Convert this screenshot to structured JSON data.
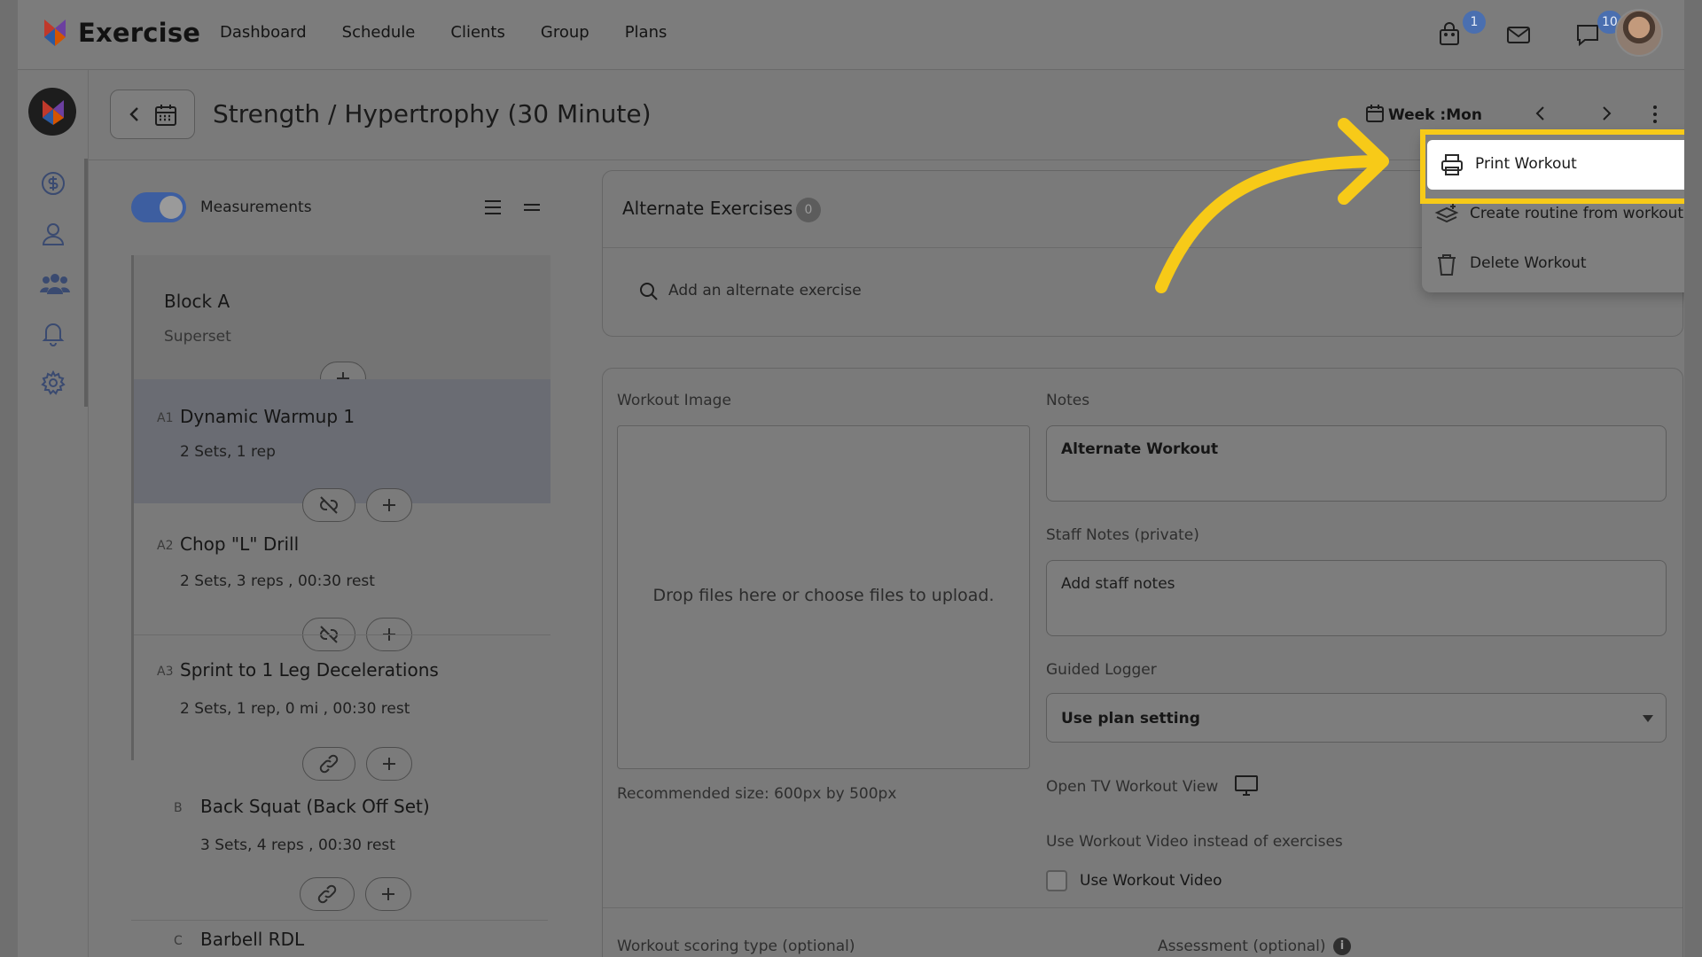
{
  "app": {
    "name": "Exercise",
    "nav": [
      "Dashboard",
      "Schedule",
      "Clients",
      "Group",
      "Plans"
    ],
    "badges": {
      "cart": "1",
      "messages": "10"
    }
  },
  "sidebar": {
    "icons": [
      "dollar-circle-icon",
      "user-icon",
      "group-icon",
      "bell-icon",
      "gear-icon"
    ]
  },
  "header": {
    "title": "Strength / Hypertrophy (30 Minute)",
    "week_label": "Week :Mon"
  },
  "left_panel": {
    "toggle_label": "Measurements",
    "toggle_on": true,
    "block_a": {
      "title": "Block A",
      "subtitle": "Superset"
    },
    "exercises": [
      {
        "code": "A1",
        "name": "Dynamic Warmup 1",
        "detail": "2 Sets, 1 rep",
        "link_icon": "unlink-icon",
        "active": true
      },
      {
        "code": "A2",
        "name": "Chop \"L\" Drill",
        "detail": "2 Sets, 3 reps , 00:30 rest",
        "link_icon": "unlink-icon",
        "active": false
      },
      {
        "code": "A3",
        "name": "Sprint to 1 Leg Decelerations",
        "detail": "2 Sets, 1 rep, 0 mi , 00:30 rest",
        "link_icon": "link-icon",
        "active": false
      },
      {
        "code": "B",
        "name": "Back Squat (Back Off Set)",
        "detail": "3 Sets, 4 reps , 00:30 rest",
        "link_icon": "link-icon",
        "active": false
      },
      {
        "code": "C",
        "name": "Barbell RDL",
        "detail": "",
        "link_icon": "",
        "active": false
      }
    ]
  },
  "alternate": {
    "title": "Alternate Exercises",
    "count": "0",
    "search_placeholder": "Add an alternate exercise"
  },
  "details": {
    "workout_image_label": "Workout Image",
    "dropzone_text": "Drop files here or choose files to upload.",
    "recommended_size": "Recommended size: 600px by 500px",
    "notes_label": "Notes",
    "notes_value": "Alternate Workout",
    "staff_notes_label": "Staff Notes (private)",
    "staff_notes_placeholder": "Add staff notes",
    "guided_logger_label": "Guided Logger",
    "guided_logger_value": "Use plan setting",
    "tv_view_label": "Open TV Workout View",
    "workout_video_label": "Use Workout Video instead of exercises",
    "workout_video_checkbox": "Use Workout Video",
    "scoring_label": "Workout scoring type (optional)",
    "assessment_label": "Assessment (optional)"
  },
  "menu": {
    "items": [
      {
        "label": "Print Workout",
        "icon": "printer-icon",
        "highlighted": true
      },
      {
        "label": "Create routine from workout",
        "icon": "layers-plus-icon",
        "highlighted": false
      },
      {
        "label": "Delete Workout",
        "icon": "trash-icon",
        "highlighted": false
      }
    ]
  },
  "annotation": {
    "highlight_color": "#f7ca18"
  }
}
